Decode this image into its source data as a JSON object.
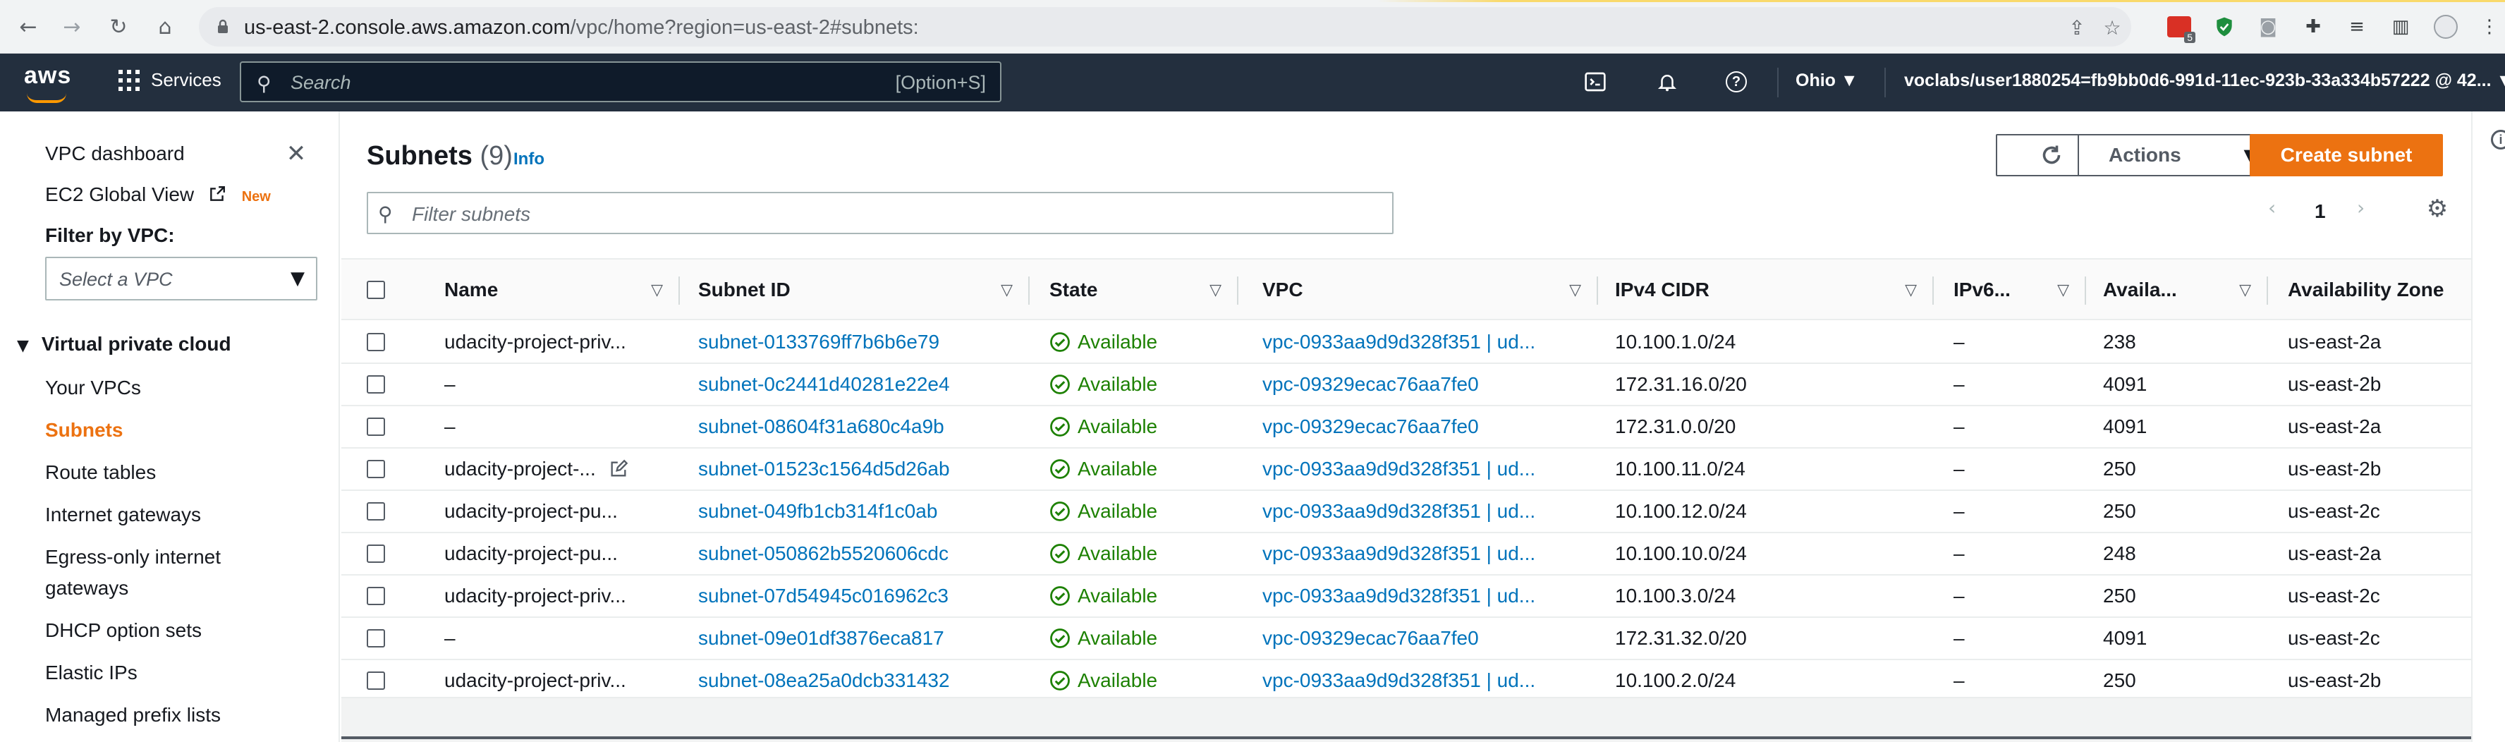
{
  "browser": {
    "url_host": "us-east-2.console.aws.amazon.com",
    "url_path": "/vpc/home?region=us-east-2#subnets:",
    "ext_badge": "5"
  },
  "aws_nav": {
    "logo": "aws",
    "services_label": "Services",
    "search_placeholder": "Search",
    "search_shortcut": "[Option+S]",
    "region": "Ohio ▼",
    "account": "voclabs/user1880254=fb9bb0d6-991d-11ec-923b-33a334b57222 @ 42...  ▼"
  },
  "sidebar": {
    "vpc_dashboard": "VPC dashboard",
    "ec2_global_view": "EC2 Global View",
    "new_badge": "New",
    "filter_label": "Filter by VPC:",
    "filter_placeholder": "Select a VPC",
    "section_title": "Virtual private cloud",
    "items": [
      {
        "label": "Your VPCs"
      },
      {
        "label": "Subnets"
      },
      {
        "label": "Route tables"
      },
      {
        "label": "Internet gateways"
      },
      {
        "label": "Egress-only internet"
      },
      {
        "label": "gateways"
      },
      {
        "label": "DHCP option sets"
      },
      {
        "label": "Elastic IPs"
      },
      {
        "label": "Managed prefix lists"
      }
    ]
  },
  "main": {
    "title": "Subnets",
    "count": "(9)",
    "info": "Info",
    "actions_label": "Actions",
    "create_label": "Create subnet",
    "filter_placeholder": "Filter subnets",
    "page_number": "1"
  },
  "table": {
    "columns": [
      "Name",
      "Subnet ID",
      "State",
      "VPC",
      "IPv4 CIDR",
      "IPv6...",
      "Availa...",
      "Availability Zone"
    ],
    "rows": [
      {
        "name": "udacity-project-priv...",
        "subnet_id": "subnet-0133769ff7b6b6e79",
        "state": "Available",
        "vpc": "vpc-0933aa9d9d328f351 | ud...",
        "cidr": "10.100.1.0/24",
        "ipv6": "–",
        "avail": "238",
        "az": "us-east-2a"
      },
      {
        "name": "–",
        "subnet_id": "subnet-0c2441d40281e22e4",
        "state": "Available",
        "vpc": "vpc-09329ecac76aa7fe0",
        "cidr": "172.31.16.0/20",
        "ipv6": "–",
        "avail": "4091",
        "az": "us-east-2b"
      },
      {
        "name": "–",
        "subnet_id": "subnet-08604f31a680c4a9b",
        "state": "Available",
        "vpc": "vpc-09329ecac76aa7fe0",
        "cidr": "172.31.0.0/20",
        "ipv6": "–",
        "avail": "4091",
        "az": "us-east-2a"
      },
      {
        "name": "udacity-project-...",
        "subnet_id": "subnet-01523c1564d5d26ab",
        "state": "Available",
        "vpc": "vpc-0933aa9d9d328f351 | ud...",
        "cidr": "10.100.11.0/24",
        "ipv6": "–",
        "avail": "250",
        "az": "us-east-2b"
      },
      {
        "name": "udacity-project-pu...",
        "subnet_id": "subnet-049fb1cb314f1c0ab",
        "state": "Available",
        "vpc": "vpc-0933aa9d9d328f351 | ud...",
        "cidr": "10.100.12.0/24",
        "ipv6": "–",
        "avail": "250",
        "az": "us-east-2c"
      },
      {
        "name": "udacity-project-pu...",
        "subnet_id": "subnet-050862b5520606cdc",
        "state": "Available",
        "vpc": "vpc-0933aa9d9d328f351 | ud...",
        "cidr": "10.100.10.0/24",
        "ipv6": "–",
        "avail": "248",
        "az": "us-east-2a"
      },
      {
        "name": "udacity-project-priv...",
        "subnet_id": "subnet-07d54945c016962c3",
        "state": "Available",
        "vpc": "vpc-0933aa9d9d328f351 | ud...",
        "cidr": "10.100.3.0/24",
        "ipv6": "–",
        "avail": "250",
        "az": "us-east-2c"
      },
      {
        "name": "–",
        "subnet_id": "subnet-09e01df3876eca817",
        "state": "Available",
        "vpc": "vpc-09329ecac76aa7fe0",
        "cidr": "172.31.32.0/20",
        "ipv6": "–",
        "avail": "4091",
        "az": "us-east-2c"
      },
      {
        "name": "udacity-project-priv...",
        "subnet_id": "subnet-08ea25a0dcb331432",
        "state": "Available",
        "vpc": "vpc-0933aa9d9d328f351 | ud...",
        "cidr": "10.100.2.0/24",
        "ipv6": "–",
        "avail": "250",
        "az": "us-east-2b"
      }
    ]
  },
  "colors": {
    "aws_nav_bg": "#232f3e",
    "accent_orange": "#ec7211",
    "link_blue": "#0073bb",
    "available_green": "#1d8102"
  },
  "icons": [
    "back-icon",
    "forward-icon",
    "reload-icon",
    "home-icon",
    "lock-icon",
    "share-icon",
    "bookmark-star-icon",
    "grid-icon",
    "search-icon",
    "cloudshell-icon",
    "bell-icon",
    "help-icon",
    "close-icon",
    "external-link-icon",
    "caret-down-icon",
    "refresh-icon",
    "chevron-left-icon",
    "chevron-right-icon",
    "settings-gear-icon",
    "sort-icon",
    "check-circle-icon",
    "edit-icon",
    "info-icon"
  ]
}
